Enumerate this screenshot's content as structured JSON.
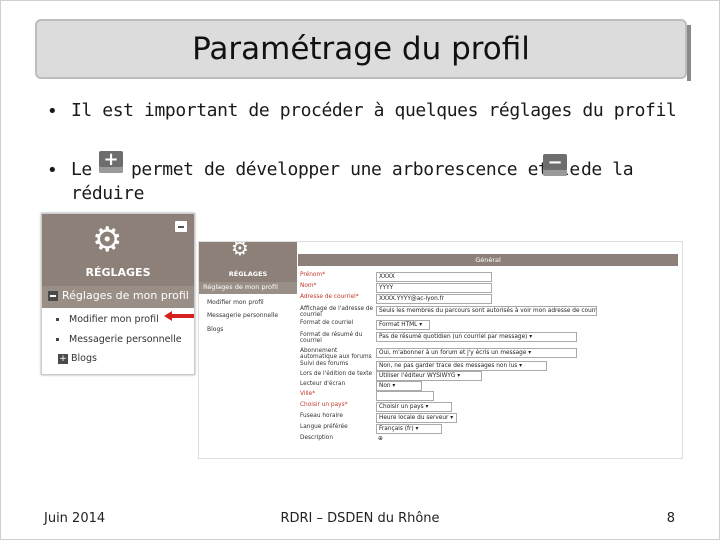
{
  "title": "Paramétrage du profil",
  "bullets": [
    {
      "symbol": "•",
      "text": "Il est important de procéder à quelques réglages du profil"
    },
    {
      "symbol": "•",
      "text_before_plus": "Le",
      "text_after_plus": "permet de développer une arborescence et le",
      "text_after_minus": "de la",
      "text_line2": "réduire"
    }
  ],
  "icons": {
    "expand": "plus-icon",
    "collapse": "minus-icon",
    "settings": "gear-icon",
    "pointer": "red-arrow-icon"
  },
  "expand_symbol": "+",
  "collapse_symbol": "−",
  "left_panel": {
    "header": "RÉGLAGES",
    "section": "Réglages de mon profil",
    "items": [
      "Modifier mon profil",
      "Messagerie personnelle"
    ],
    "blogs": "Blogs"
  },
  "right_panel": {
    "menu_header": "RÉGLAGES",
    "menu_section": "Réglages de mon profil",
    "menu_items": [
      "Modifier mon profil",
      "Messagerie personnelle",
      "Blogs"
    ],
    "form_header": "Général",
    "fields": [
      {
        "label": "Prénom*",
        "value": "XXXX",
        "required": true
      },
      {
        "label": "Nom*",
        "value": "YYYY",
        "required": true
      },
      {
        "label": "Adresse de courriel*",
        "value": "XXXX.YYYY@ac-lyon.fr",
        "required": true
      },
      {
        "label": "Affichage de l'adresse de courriel",
        "value": "Seuls les membres du parcours sont autorisés à voir mon adresse de courriel ▾",
        "required": false
      },
      {
        "label": "Format de courriel",
        "value": "Format HTML ▾",
        "required": false
      },
      {
        "label": "Format de résumé du courriel",
        "value": "Pas de résumé quotidien (un courriel par message) ▾",
        "required": false
      },
      {
        "label": "Abonnement automatique aux forums",
        "value": "Oui, m'abonner à un forum et j'y écris un message ▾",
        "required": false
      },
      {
        "label": "Suivi des forums",
        "value": "Non, ne pas garder trace des messages non lus ▾",
        "required": false
      },
      {
        "label": "Lors de l'édition de texte",
        "value": "Utiliser l'éditeur WYSIWYG ▾",
        "required": false
      },
      {
        "label": "Lecteur d'écran",
        "value": "Non ▾",
        "required": false
      },
      {
        "label": "Ville*",
        "value": "",
        "required": true
      },
      {
        "label": "Choisir un pays*",
        "value": "Choisir un pays ▾",
        "required": true
      },
      {
        "label": "Fuseau horaire",
        "value": "Heure locale du serveur ▾",
        "required": false
      },
      {
        "label": "Langue préférée",
        "value": "Français (fr) ▾",
        "required": false
      },
      {
        "label": "Description",
        "value": "⊕",
        "required": false
      }
    ]
  },
  "footer": {
    "date": "Juin 2014",
    "center": "RDRI – DSDEN du Rhône",
    "page": "8"
  },
  "colors": {
    "title_bar": "#dcdcdc",
    "panel_header": "#8c8079",
    "arrow": "#d62020"
  }
}
